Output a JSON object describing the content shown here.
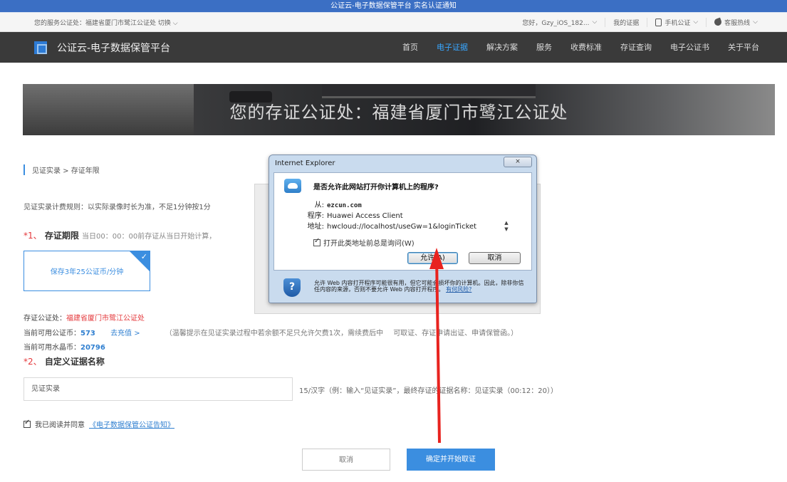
{
  "notice": {
    "text": "公证云-电子数据保管平台 实名认证通知"
  },
  "topbar": {
    "service_office": "您的服务公证处：福建省厦门市鹭江公证处 切换",
    "greeting": "您好，Gzy_iOS_182...",
    "my_evidence": "我的证据",
    "mobile_notary": "手机公证",
    "hotline": "客服热线"
  },
  "nav": {
    "brand": "公证云-电子数据保管平台",
    "links": [
      "首页",
      "电子证据",
      "解决方案",
      "服务",
      "收费标准",
      "存证查询",
      "电子公证书",
      "关于平台"
    ]
  },
  "banner": {
    "title": "您的存证公证处：福建省厦门市鹭江公证处"
  },
  "breadcrumb": "见证实录 > 存证年限",
  "rule_text": "见证实录计费规则：以实际录像时长为准，不足1分钟按1分",
  "section1": {
    "num": "*1、",
    "title": "存证期限",
    "hint": "当日00：00：00前存证从当日开始计算，"
  },
  "plan": {
    "label": "保存3年25公证币/分钟"
  },
  "info": {
    "office_label": "存证公证处：",
    "office_value": "福建省厦门市鹭江公证处",
    "coin_label": "当前可用公证币：",
    "coin_value": "573",
    "recharge": "去充值 >",
    "tip": "（温馨提示在见证实录过程中若余额不足只允许欠费1次，需续费后中",
    "tip_rest": "可取证、存证申请出证、申请保管函。）",
    "crystal_label": "当前可用水晶币：",
    "crystal_value": "20796"
  },
  "section2": {
    "num": "*2、",
    "title": "自定义证据名称"
  },
  "name_input": {
    "value": "见证实录"
  },
  "name_hint": "15/汉字（例：输入“见证实录”，最终存证的证据名称：见证实录（00:12：20））",
  "agree": {
    "text": "我已阅读并同意",
    "link": "《电子数据保管公证告知》"
  },
  "buttons": {
    "cancel": "取消",
    "confirm": "确定并开始取证"
  },
  "dialog": {
    "title": "Internet Explorer",
    "close": "⨯",
    "question": "是否允许此网站打开你计算机上的程序?",
    "from_label": "从:",
    "from_value": "ezcun.com",
    "program_label": "程序:",
    "program_value": "Huawei Access Client",
    "address_label": "地址:",
    "address_value": "hwcloud://localhost/useGw=1&loginTicket",
    "checkbox_label": "打开此类地址前总是询问(W)",
    "allow": "允许(A)",
    "cancel": "取消",
    "footer_text": "允许 Web 内容打开程序可能很有用，但它可能会损坏你的计算机。因此，除非你信任内容的来源，否则不要允许 Web 内容打开程序。",
    "footer_link": "有何风险?"
  },
  "colors": {
    "accent": "#3b8ee0",
    "required": "#e4393c",
    "nav_bg": "#3a3a3a",
    "arrow": "#e8231f"
  }
}
